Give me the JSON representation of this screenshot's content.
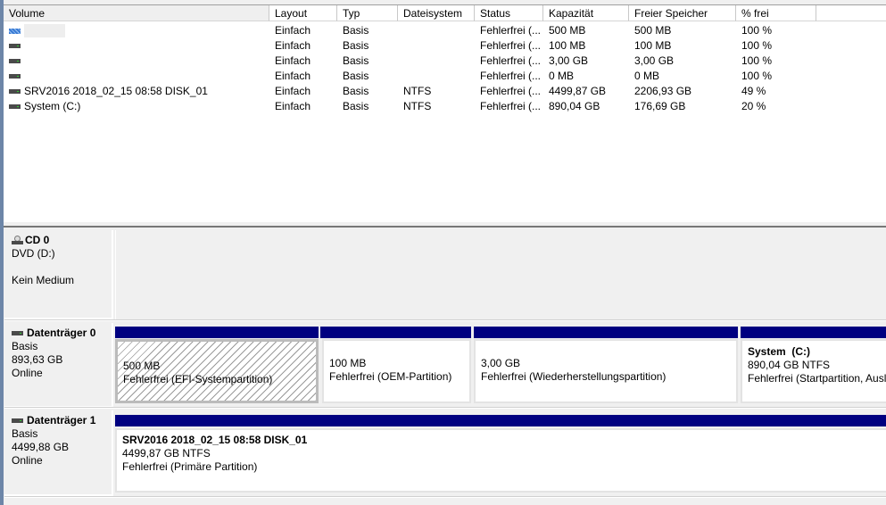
{
  "columns": [
    "Volume",
    "Layout",
    "Typ",
    "Dateisystem",
    "Status",
    "Kapazität",
    "Freier Speicher",
    "% frei"
  ],
  "volumes": [
    {
      "name": "",
      "layout": "Einfach",
      "type": "Basis",
      "fs": "",
      "status": "Fehlerfrei (...",
      "capacity": "500 MB",
      "free": "500 MB",
      "pct": "100 %",
      "icon": "efi-volume-icon"
    },
    {
      "name": "",
      "layout": "Einfach",
      "type": "Basis",
      "fs": "",
      "status": "Fehlerfrei (...",
      "capacity": "100 MB",
      "free": "100 MB",
      "pct": "100 %",
      "icon": "volume-icon"
    },
    {
      "name": "",
      "layout": "Einfach",
      "type": "Basis",
      "fs": "",
      "status": "Fehlerfrei (...",
      "capacity": "3,00 GB",
      "free": "3,00 GB",
      "pct": "100 %",
      "icon": "volume-icon"
    },
    {
      "name": "",
      "layout": "Einfach",
      "type": "Basis",
      "fs": "",
      "status": "Fehlerfrei (...",
      "capacity": "0 MB",
      "free": "0 MB",
      "pct": "100 %",
      "icon": "volume-icon"
    },
    {
      "name": "SRV2016 2018_02_15 08:58 DISK_01",
      "layout": "Einfach",
      "type": "Basis",
      "fs": "NTFS",
      "status": "Fehlerfrei (...",
      "capacity": "4499,87 GB",
      "free": "2206,93 GB",
      "pct": "49 %",
      "icon": "volume-icon"
    },
    {
      "name": "System (C:)",
      "layout": "Einfach",
      "type": "Basis",
      "fs": "NTFS",
      "status": "Fehlerfrei (...",
      "capacity": "890,04 GB",
      "free": "176,69 GB",
      "pct": "20 %",
      "icon": "volume-icon"
    }
  ],
  "cd": {
    "title": "CD 0",
    "drive": "DVD (D:)",
    "state": "Kein Medium"
  },
  "disk0": {
    "title": "Datenträger 0",
    "type": "Basis",
    "size": "893,63 GB",
    "state": "Online",
    "partitions": [
      {
        "name": "",
        "size": "500 MB",
        "status": "Fehlerfrei (EFI-Systempartition)"
      },
      {
        "name": "",
        "size": "100 MB",
        "status": "Fehlerfrei (OEM-Partition)"
      },
      {
        "name": "",
        "size": "3,00 GB",
        "status": "Fehlerfrei (Wiederherstellungspartition)"
      },
      {
        "name": "System  (C:)",
        "size": "890,04 GB NTFS",
        "status": "Fehlerfrei (Startpartition, Auslagerungsdatei, Absturzabbild, Primäre Partition)"
      }
    ]
  },
  "disk1": {
    "title": "Datenträger 1",
    "type": "Basis",
    "size": "4499,88 GB",
    "state": "Online",
    "partitions": [
      {
        "name": "SRV2016 2018_02_15 08:58 DISK_01",
        "size": "4499,87 GB NTFS",
        "status": "Fehlerfrei (Primäre Partition)"
      }
    ]
  },
  "colors": {
    "partition_bar": "#000080"
  }
}
